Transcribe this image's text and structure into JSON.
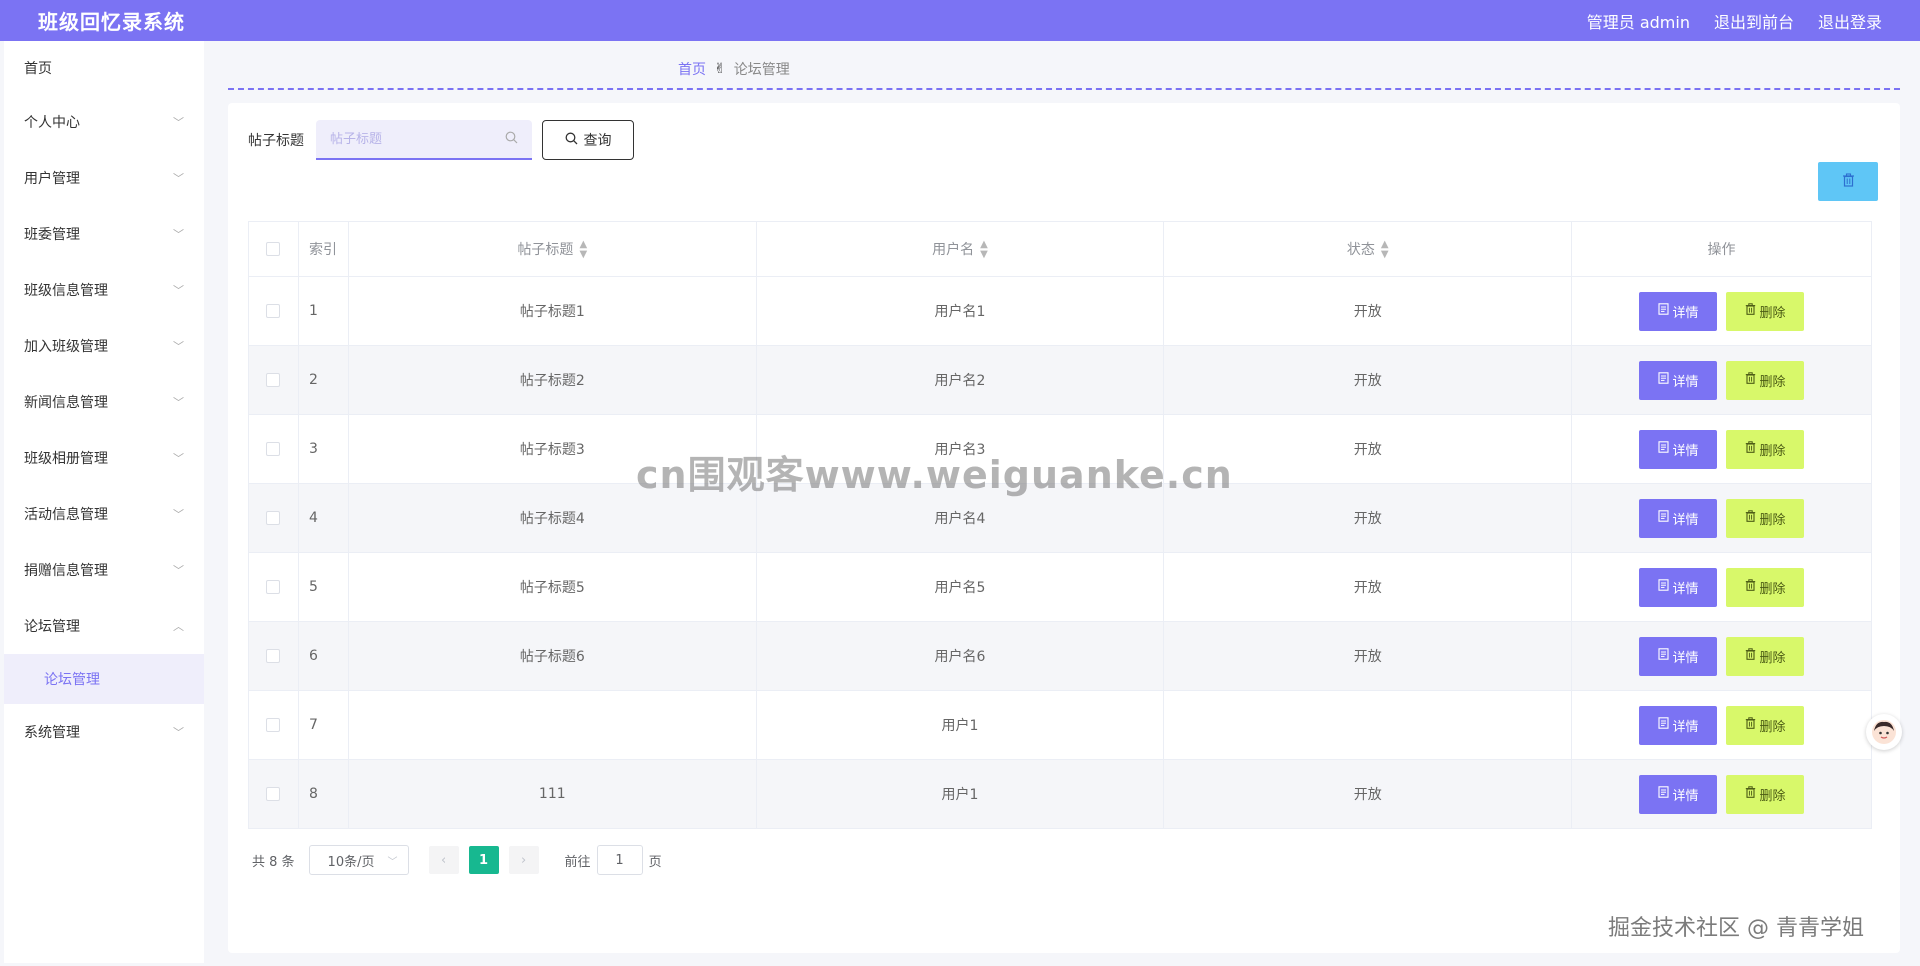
{
  "header": {
    "title": "班级回忆录系统",
    "admin_label": "管理员 admin",
    "to_front_label": "退出到前台",
    "logout_label": "退出登录"
  },
  "sidebar": {
    "items": [
      {
        "label": "首页"
      },
      {
        "label": "个人中心"
      },
      {
        "label": "用户管理"
      },
      {
        "label": "班委管理"
      },
      {
        "label": "班级信息管理"
      },
      {
        "label": "加入班级管理"
      },
      {
        "label": "新闻信息管理"
      },
      {
        "label": "班级相册管理"
      },
      {
        "label": "活动信息管理"
      },
      {
        "label": "捐赠信息管理"
      },
      {
        "label": "论坛管理"
      },
      {
        "label": "系统管理"
      }
    ],
    "submenu_active": "论坛管理"
  },
  "breadcrumb": {
    "home": "首页",
    "separator": "✌",
    "current": "论坛管理"
  },
  "search": {
    "label": "帖子标题",
    "placeholder": "帖子标题",
    "query_label": "查询"
  },
  "table": {
    "headers": {
      "index": "索引",
      "title": "帖子标题",
      "user": "用户名",
      "status": "状态",
      "ops": "操作"
    },
    "detail_label": "详情",
    "delete_label": "删除",
    "rows": [
      {
        "index": "1",
        "title": "帖子标题1",
        "user": "用户名1",
        "status": "开放"
      },
      {
        "index": "2",
        "title": "帖子标题2",
        "user": "用户名2",
        "status": "开放"
      },
      {
        "index": "3",
        "title": "帖子标题3",
        "user": "用户名3",
        "status": "开放"
      },
      {
        "index": "4",
        "title": "帖子标题4",
        "user": "用户名4",
        "status": "开放"
      },
      {
        "index": "5",
        "title": "帖子标题5",
        "user": "用户名5",
        "status": "开放"
      },
      {
        "index": "6",
        "title": "帖子标题6",
        "user": "用户名6",
        "status": "开放"
      },
      {
        "index": "7",
        "title": "",
        "user": "用户1",
        "status": ""
      },
      {
        "index": "8",
        "title": "111",
        "user": "用户1",
        "status": "开放"
      }
    ]
  },
  "pagination": {
    "total": "共 8 条",
    "page_size": "10条/页",
    "current_page": "1",
    "goto_label": "前往",
    "goto_value": "1",
    "goto_unit": "页"
  },
  "watermarks": {
    "center": "cn围观客www.weiguanke.cn",
    "corner": "掘金技术社区 @ 青青学姐"
  },
  "colors": {
    "primary": "#7b73f3",
    "delete_btn": "#d8f86a",
    "bulk_delete": "#5fc6f6",
    "active_page": "#17b890"
  }
}
